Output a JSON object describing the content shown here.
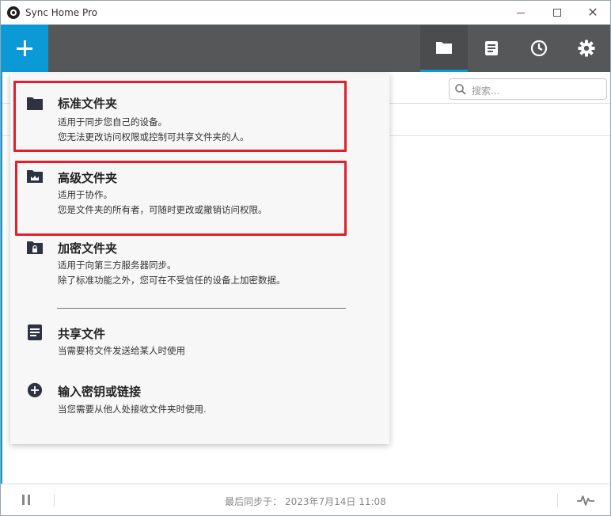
{
  "window": {
    "title": "Sync Home Pro"
  },
  "toolbar": {
    "add_icon": "plus-icon",
    "tabs": [
      {
        "icon": "folder-icon",
        "active": true
      },
      {
        "icon": "file-list-icon",
        "active": false
      },
      {
        "icon": "clock-icon",
        "active": false
      },
      {
        "icon": "gear-icon",
        "active": false
      }
    ]
  },
  "search": {
    "placeholder": "搜索..."
  },
  "menu": {
    "items": [
      {
        "icon": "folder-icon",
        "title": "标准文件夹",
        "desc1": "适用于同步您自己的设备。",
        "desc2": "您无法更改访问权限或控制可共享文件夹的人。",
        "highlighted": true
      },
      {
        "icon": "crown-folder-icon",
        "title": "高级文件夹",
        "desc1": "适用于协作。",
        "desc2": "您是文件夹的所有者，可随时更改或撤销访问权限。",
        "highlighted": true
      },
      {
        "icon": "lock-folder-icon",
        "title": "加密文件夹",
        "desc1": "适用于向第三方服务器同步。",
        "desc2": "除了标准功能之外，您可在不受信任的设备上加密数据。",
        "highlighted": false
      },
      {
        "icon": "document-icon",
        "title": "共享文件",
        "desc1": "当需要将文件发送给某人时使用",
        "highlighted": false
      },
      {
        "icon": "add-circle-icon",
        "title": "输入密钥或链接",
        "desc1": "当您需要从他人处接收文件夹时使用.",
        "highlighted": false
      }
    ]
  },
  "status": {
    "last_sync": "最后同步于： 2023年7月14日 11:08"
  },
  "colors": {
    "accent": "#0c9ad6",
    "toolbar": "#555759",
    "highlight": "#e0202a"
  }
}
